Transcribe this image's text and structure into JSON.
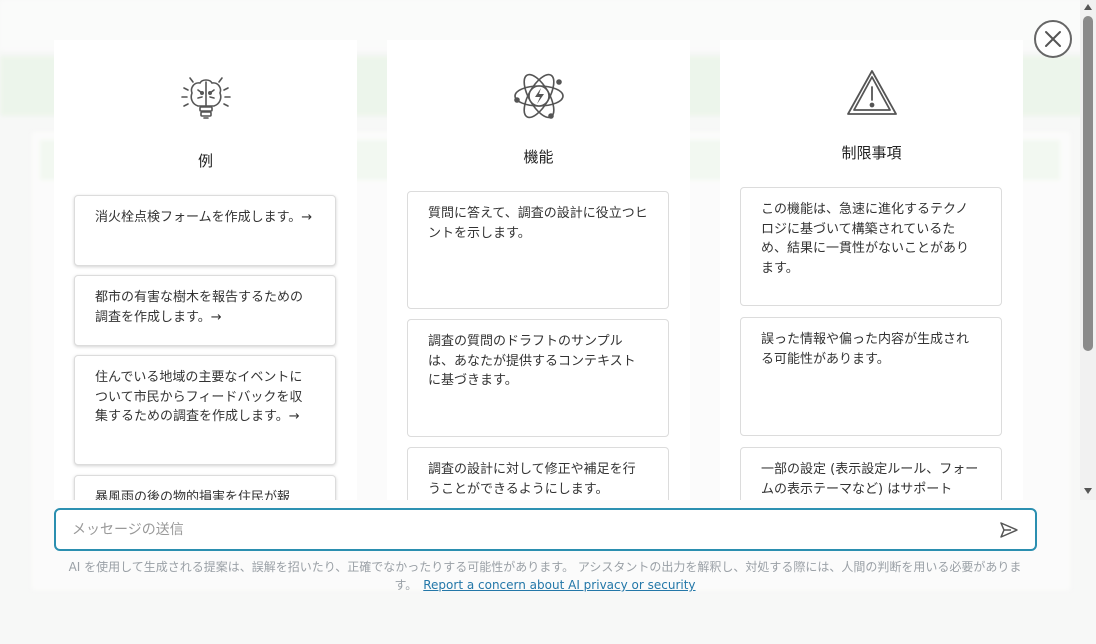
{
  "columns": {
    "examples": {
      "title": "例",
      "icon": "brain-icon",
      "cards": [
        {
          "text": "消火栓点検フォームを作成します。→"
        },
        {
          "text": "都市の有害な樹木を報告するための調査を作成します。→"
        },
        {
          "text": "住んでいる地域の主要なイベントについて市民からフィードバックを収集するための調査を作成します。→"
        },
        {
          "text": "暴風雨の後の物的損害を住民が報"
        }
      ]
    },
    "capabilities": {
      "title": "機能",
      "icon": "atom-bolt-icon",
      "cards": [
        {
          "text": "質問に答えて、調査の設計に役立つヒントを示します。"
        },
        {
          "text": "調査の質問のドラフトのサンプルは、あなたが提供するコンテキストに基づきます。"
        },
        {
          "text": "調査の設計に対して修正や補足を行うことができるようにします。"
        }
      ]
    },
    "limitations": {
      "title": "制限事項",
      "icon": "warning-icon",
      "cards": [
        {
          "text": "この機能は、急速に進化するテクノロジに基づいて構築されているため、結果に一貫性がないことがあります。"
        },
        {
          "text": "誤った情報や偏った内容が生成される可能性があります。"
        },
        {
          "text": "一部の設定 (表示設定ルール、フォームの表示テーマなど) はサポート"
        }
      ]
    }
  },
  "message": {
    "placeholder": "メッセージの送信",
    "value": ""
  },
  "disclaimer": {
    "text": "AI を使用して生成される提案は、誤解を招いたり、正確でなかったりする可能性があります。 アシスタントの出力を解釈し、対処する際には、人間の判断を用いる必要があります。",
    "link_label": "Report a concern about AI privacy or security"
  },
  "colors": {
    "accent": "#2b8fb0",
    "link": "#2377a8",
    "background_green": "#d6e8d2"
  }
}
